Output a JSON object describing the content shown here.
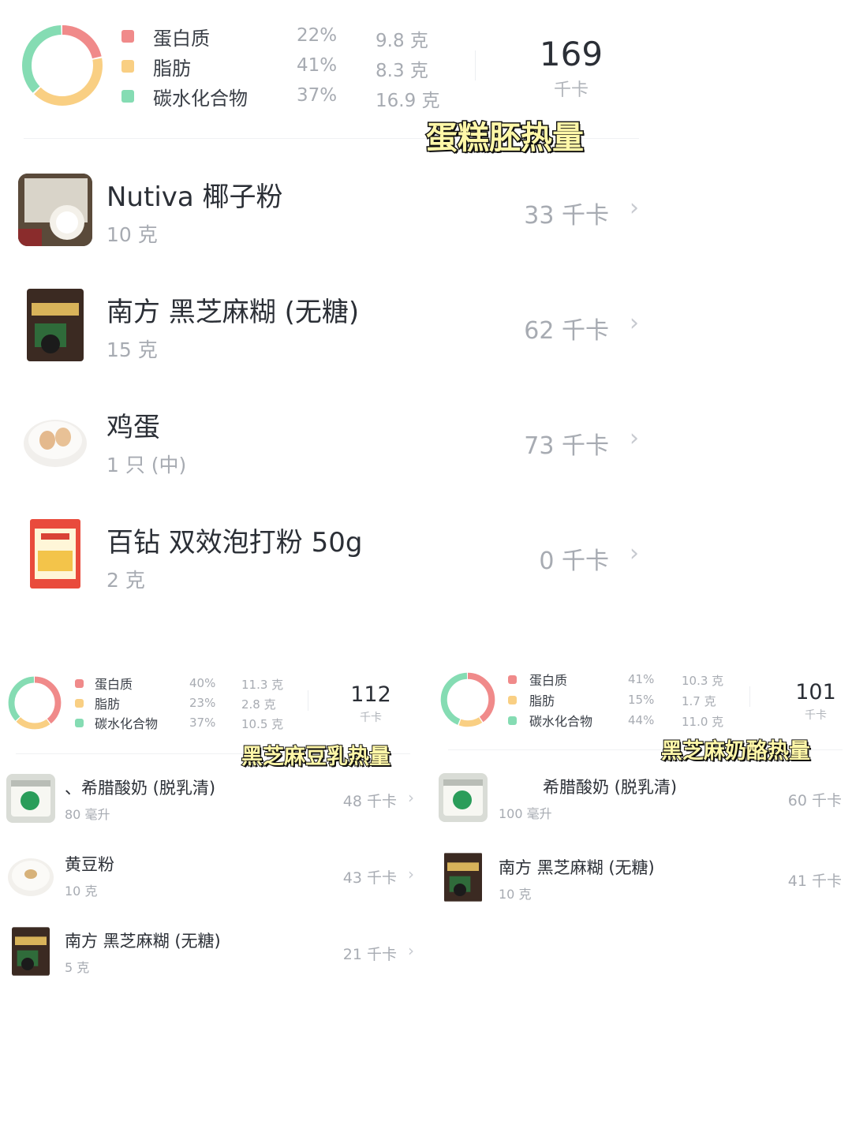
{
  "colors": {
    "protein": "#f08a8a",
    "fat": "#f9cf83",
    "carb": "#85dcb3"
  },
  "main": {
    "donut": {
      "protein_pct": 22,
      "fat_pct": 41,
      "carb_pct": 37
    },
    "macros": [
      {
        "name": "蛋白质",
        "pct": "22%",
        "grams": "9.8 克"
      },
      {
        "name": "脂肪",
        "pct": "41%",
        "grams": "8.3 克"
      },
      {
        "name": "碳水化合物",
        "pct": "37%",
        "grams": "16.9 克"
      }
    ],
    "kcal": "169",
    "unit": "千卡",
    "sticker": "蛋糕胚热量",
    "items": [
      {
        "name": "Nutiva 椰子粉",
        "qty": "10 克",
        "kcal": "33 千卡",
        "icon": "coconut-flour-package"
      },
      {
        "name": "南方 黑芝麻糊 (无糖)",
        "qty": "15 克",
        "kcal": "62 千卡",
        "icon": "black-sesame-package"
      },
      {
        "name": "鸡蛋",
        "qty": "1 只 (中)",
        "kcal": "73 千卡",
        "icon": "eggs-plate"
      },
      {
        "name": "百钻 双效泡打粉 50g",
        "qty": "2 克",
        "kcal": "0 千卡",
        "icon": "baking-powder-package"
      }
    ]
  },
  "left": {
    "donut": {
      "protein_pct": 40,
      "fat_pct": 23,
      "carb_pct": 37
    },
    "macros": [
      {
        "name": "蛋白质",
        "pct": "40%",
        "grams": "11.3 克"
      },
      {
        "name": "脂肪",
        "pct": "23%",
        "grams": "2.8 克"
      },
      {
        "name": "碳水化合物",
        "pct": "37%",
        "grams": "10.5 克"
      }
    ],
    "kcal": "112",
    "unit": "千卡",
    "sticker": "黑芝麻豆乳热量",
    "items": [
      {
        "name": "、希腊酸奶 (脱乳清)",
        "qty": "80 毫升",
        "kcal": "48 千卡",
        "icon": "yogurt-tub"
      },
      {
        "name": "黄豆粉",
        "qty": "10 克",
        "kcal": "43 千卡",
        "icon": "soy-flour-plate"
      },
      {
        "name": "南方 黑芝麻糊 (无糖)",
        "qty": "5 克",
        "kcal": "21 千卡",
        "icon": "black-sesame-package"
      }
    ]
  },
  "right": {
    "donut": {
      "protein_pct": 41,
      "fat_pct": 15,
      "carb_pct": 44
    },
    "macros": [
      {
        "name": "蛋白质",
        "pct": "41%",
        "grams": "10.3 克"
      },
      {
        "name": "脂肪",
        "pct": "15%",
        "grams": "1.7 克"
      },
      {
        "name": "碳水化合物",
        "pct": "44%",
        "grams": "11.0 克"
      }
    ],
    "kcal": "101",
    "unit": "千卡",
    "sticker": "黑芝麻奶酪热量",
    "items": [
      {
        "name": "希腊酸奶 (脱乳清)",
        "qty": "100 毫升",
        "kcal": "60 千卡",
        "icon": "yogurt-tub"
      },
      {
        "name": "南方 黑芝麻糊 (无糖)",
        "qty": "10 克",
        "kcal": "41 千卡",
        "icon": "black-sesame-package"
      }
    ]
  }
}
